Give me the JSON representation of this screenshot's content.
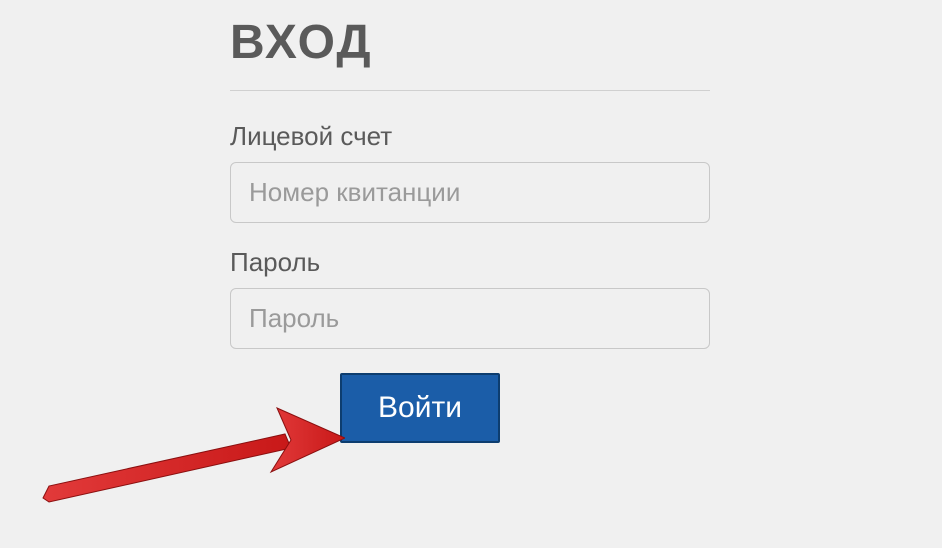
{
  "title": "ВХОД",
  "fields": {
    "account": {
      "label": "Лицевой счет",
      "placeholder": "Номер квитанции",
      "value": ""
    },
    "password": {
      "label": "Пароль",
      "placeholder": "Пароль",
      "value": ""
    }
  },
  "submit_label": "Войти",
  "colors": {
    "primary": "#1b5da8",
    "arrow": "#d62424"
  }
}
